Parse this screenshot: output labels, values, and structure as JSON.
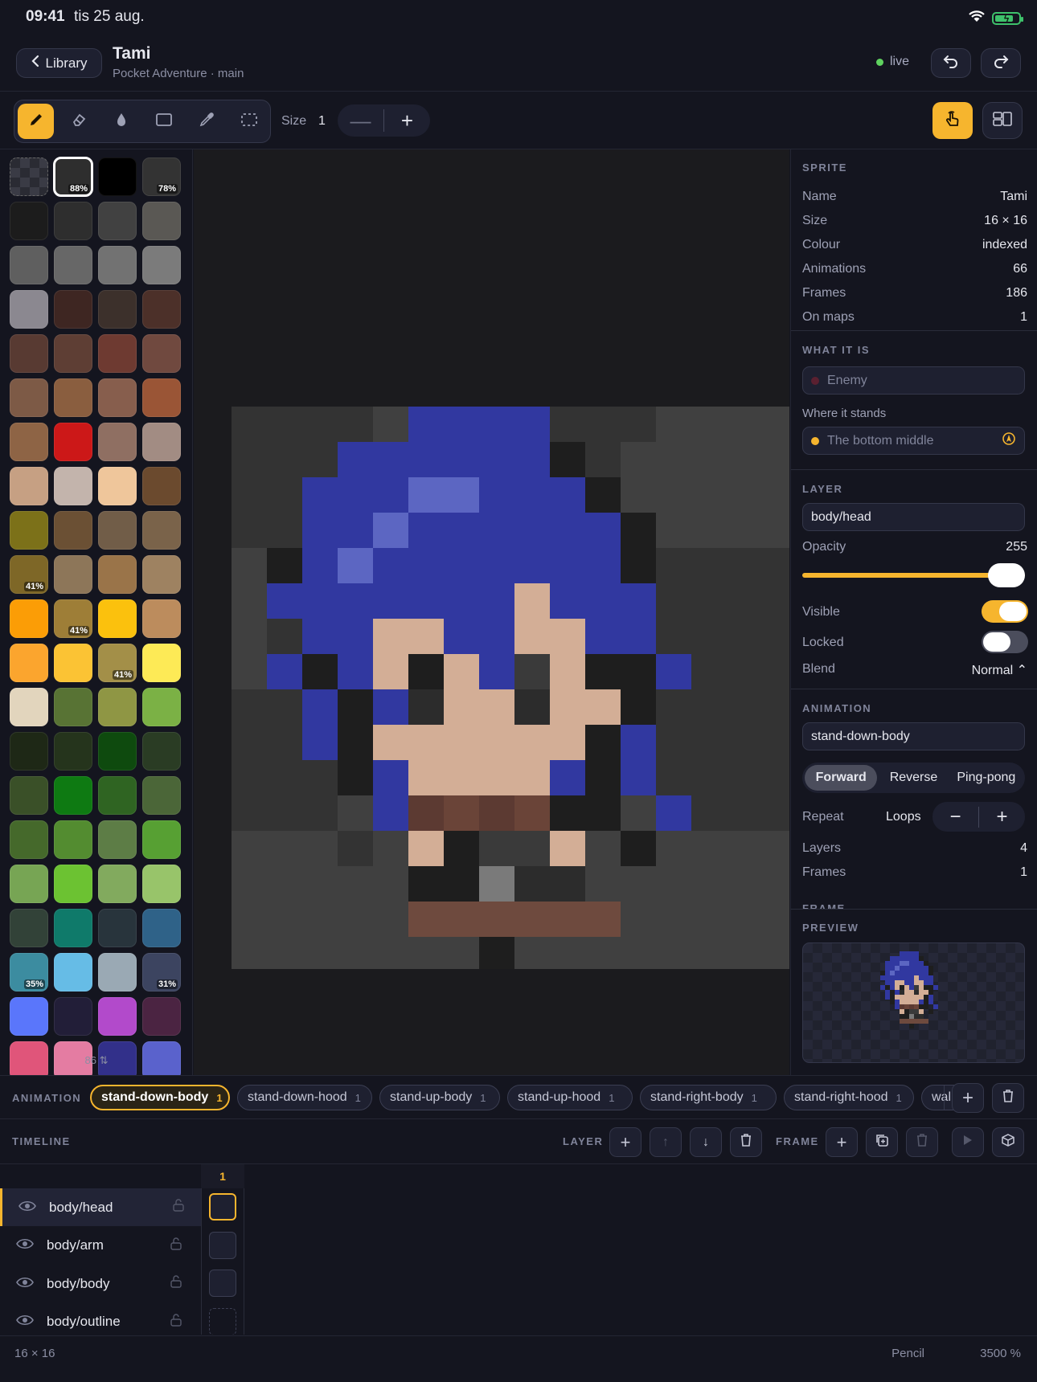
{
  "status": {
    "time": "09:41",
    "date": "tis 25 aug."
  },
  "header": {
    "back_label": "Library",
    "title": "Tami",
    "subtitle": "Pocket Adventure · main",
    "live_label": "live"
  },
  "toolbar": {
    "tools": [
      "pencil-icon",
      "eraser-icon",
      "fill-icon",
      "rectangle-icon",
      "eyedropper-icon",
      "selection-icon"
    ],
    "active_tool": "pencil-icon",
    "size_label": "Size",
    "size_value": "1"
  },
  "palette": {
    "count_label": "86 ⇅",
    "swatches": [
      {
        "c": "transparent"
      },
      {
        "c": "#2e2e2e",
        "p": "88%",
        "sel": true
      },
      {
        "c": "#000000"
      },
      {
        "c": "#333333",
        "p": "78%"
      },
      {
        "c": "#1c1c1c"
      },
      {
        "c": "#2e2e2e"
      },
      {
        "c": "#414141"
      },
      {
        "c": "#5a5854"
      },
      {
        "c": "#5f5f5f"
      },
      {
        "c": "#676767"
      },
      {
        "c": "#727272"
      },
      {
        "c": "#7b7b7b"
      },
      {
        "c": "#8b8890"
      },
      {
        "c": "#3e2622"
      },
      {
        "c": "#3c302b"
      },
      {
        "c": "#4c3029"
      },
      {
        "c": "#583a32"
      },
      {
        "c": "#5e3e34"
      },
      {
        "c": "#6e3a31"
      },
      {
        "c": "#70493f"
      },
      {
        "c": "#7d5a46"
      },
      {
        "c": "#8a5e3f"
      },
      {
        "c": "#875e4d"
      },
      {
        "c": "#9a5536"
      },
      {
        "c": "#8e6445"
      },
      {
        "c": "#cc1818"
      },
      {
        "c": "#8f6f62"
      },
      {
        "c": "#a28c83"
      },
      {
        "c": "#c6a083"
      },
      {
        "c": "#c3b4ac"
      },
      {
        "c": "#efc69b"
      },
      {
        "c": "#6b4a2e"
      },
      {
        "c": "#7c7119"
      },
      {
        "c": "#6b5034"
      },
      {
        "c": "#715d48"
      },
      {
        "c": "#7a634a"
      },
      {
        "c": "#7e6727",
        "p": "41%"
      },
      {
        "c": "#8d7659"
      },
      {
        "c": "#9a7449"
      },
      {
        "c": "#9e8261"
      },
      {
        "c": "#fb9d06"
      },
      {
        "c": "#9e7e37",
        "p": "41%"
      },
      {
        "c": "#fbc10d"
      },
      {
        "c": "#bc8c5d"
      },
      {
        "c": "#fba52e"
      },
      {
        "c": "#fbc334"
      },
      {
        "c": "#a38f48",
        "p": "41%"
      },
      {
        "c": "#fdea56"
      },
      {
        "c": "#e2d5bd"
      },
      {
        "c": "#587334"
      },
      {
        "c": "#8f9644"
      },
      {
        "c": "#7bb145"
      },
      {
        "c": "#1e2816"
      },
      {
        "c": "#25341c"
      },
      {
        "c": "#0e4a0e"
      },
      {
        "c": "#2a3c24"
      },
      {
        "c": "#3a5028"
      },
      {
        "c": "#0e7a12"
      },
      {
        "c": "#2f6422"
      },
      {
        "c": "#4b6638"
      },
      {
        "c": "#45692b"
      },
      {
        "c": "#538c30"
      },
      {
        "c": "#5d7d46"
      },
      {
        "c": "#57a033"
      },
      {
        "c": "#77a554"
      },
      {
        "c": "#6cc232"
      },
      {
        "c": "#82aa5e"
      },
      {
        "c": "#98c46a"
      },
      {
        "c": "#324238"
      },
      {
        "c": "#0f7a6a"
      },
      {
        "c": "#28343c"
      },
      {
        "c": "#2f6288"
      },
      {
        "c": "#3c8ca0",
        "p": "35%"
      },
      {
        "c": "#66bce6"
      },
      {
        "c": "#9aa9b4"
      },
      {
        "c": "#3c4460",
        "p": "31%"
      },
      {
        "c": "#5a76fb"
      },
      {
        "c": "#221e38"
      },
      {
        "c": "#b24acb"
      },
      {
        "c": "#4b2442"
      },
      {
        "c": "#e0557a"
      },
      {
        "c": "#e47ca2"
      },
      {
        "c": "#32308a"
      },
      {
        "c": "#5a62cc"
      }
    ]
  },
  "canvas": {
    "palette": {
      ".": "#1b1b1e",
      "a": "#333333",
      "b": "#404040",
      "k": "#1e1e1e",
      "B": "#3138a0",
      "L": "#5c66c2",
      "S": "#d3ae96",
      "D": "#2c2c2c",
      "M": "#5c3a32",
      "N": "#6a4438",
      "G": "#7a7a7a",
      "H": "#3a3a3a",
      "R": "#6e4a3e"
    },
    "rows": [
      "aaaabBBBBaaabbbb",
      "aaaBBBBBBkabbbbb",
      "aaBBBLLBBBkbbbbb",
      "aaBBLBBBBBBkbbbb",
      "bkBLBBBBBBBkaaaa",
      "bBBBBBBBSBBBaaaa",
      "baBBSSBBSSBBaaaa",
      "bBkBSkSBHSkkBaaa",
      "aaBkBDSSDSSkaaaa",
      "aaBkSSSSSSkBaaaa",
      "aaakBSSSSBkBaaaa",
      "aaabBMNMNkkbBaaa",
      "bbbabSkHHSbkbbbb",
      "bbbbbkkGDDbbbbbb",
      "bbbbbRRRRRRbbbbb",
      "bbbbbbbkbbbbbbbb"
    ],
    "dimensions": "16 × 16",
    "zoom": "3500 %",
    "tool_name": "Pencil"
  },
  "sprite": {
    "section": "SPRITE",
    "rows": [
      {
        "k": "Name",
        "v": "Tami"
      },
      {
        "k": "Size",
        "v": "16 × 16"
      },
      {
        "k": "Colour",
        "v": "indexed"
      },
      {
        "k": "Animations",
        "v": "66"
      },
      {
        "k": "Frames",
        "v": "186"
      },
      {
        "k": "On maps",
        "v": "1"
      }
    ]
  },
  "what_it_is": {
    "section": "WHAT IT IS",
    "kind_placeholder": "Enemy",
    "anchor_label": "Where it stands",
    "anchor_placeholder": "The bottom middle",
    "kind_color": "#5a2030",
    "anchor_color": "#f6b52e"
  },
  "layer": {
    "section": "LAYER",
    "name": "body/head",
    "opacity_label": "Opacity",
    "opacity_value": "255",
    "opacity_fraction": 1.0,
    "visible_label": "Visible",
    "visible": true,
    "locked_label": "Locked",
    "locked": false,
    "blend_label": "Blend",
    "blend_value": "Normal ⌃"
  },
  "animation": {
    "section": "ANIMATION",
    "name": "stand-down-body",
    "modes": [
      "Forward",
      "Reverse",
      "Ping-pong"
    ],
    "active_mode": "Forward",
    "repeat_label": "Repeat",
    "repeat_value": "Loops",
    "layers_label": "Layers",
    "layers_value": "4",
    "frames_label": "Frames",
    "frames_value": "1",
    "next_section": "FRAME"
  },
  "preview": {
    "section": "PREVIEW"
  },
  "animbar": {
    "label": "ANIMATION",
    "chips": [
      {
        "name": "stand-down-body",
        "n": "1",
        "on": true
      },
      {
        "name": "stand-down-hood",
        "n": "1"
      },
      {
        "name": "stand-up-body",
        "n": "1"
      },
      {
        "name": "stand-up-hood",
        "n": "1"
      },
      {
        "name": "stand-right-body",
        "n": "1"
      },
      {
        "name": "stand-right-hood",
        "n": "1"
      },
      {
        "name": "wall",
        "n": ""
      }
    ]
  },
  "timeline": {
    "label": "TIMELINE",
    "layer_label": "LAYER",
    "frame_label": "FRAME",
    "frame_number": "1",
    "layers": [
      "body/head",
      "body/arm",
      "body/body",
      "body/outline"
    ],
    "active_layer": "body/head"
  },
  "colors": {
    "accent": "#f6b52e",
    "bg": "#14151f",
    "panel": "#1e2030"
  }
}
